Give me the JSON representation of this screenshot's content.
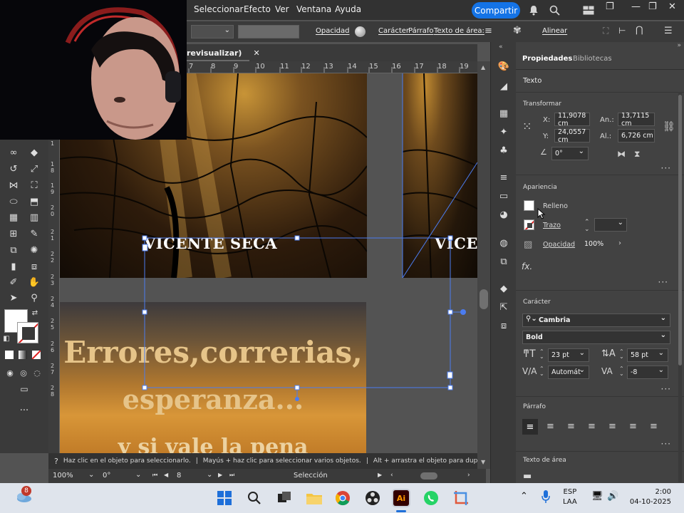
{
  "menu": {
    "items": [
      "Seleccionar",
      "Efecto",
      "Ver",
      "Ventana",
      "Ayuda"
    ],
    "share_label": "Compartir"
  },
  "controlbar": {
    "opacity_label": "Opacidad",
    "caracter_label": "Carácter",
    "parrafo_label": "Párrafo",
    "texto_area_label": "Texto de área:",
    "alinear_label": "Alinear"
  },
  "document": {
    "tab_title": "revisualizar)",
    "ruler_top": [
      "7",
      "8",
      "9",
      "10",
      "11",
      "12",
      "13",
      "14",
      "15",
      "16",
      "17",
      "18",
      "19"
    ],
    "ruler_left": [
      "1",
      "1",
      "8",
      "1",
      "9",
      "2",
      "0",
      "2",
      "1",
      "2",
      "2",
      "2",
      "3",
      "2",
      "4",
      "2",
      "5",
      "2",
      "6",
      "2",
      "7",
      "2",
      "8"
    ]
  },
  "canvas": {
    "heading_text": "VICENTE SECA",
    "heading_text_clipped": "VICE",
    "quote_line1": "Errores,correrias,",
    "quote_line2": "esperanza...",
    "quote_line3": "y si  vale la pena"
  },
  "status": {
    "hint_1": "Haz clic en el objeto para seleccionarlo.",
    "hint_2": "Mayús + haz clic para seleccionar varios objetos.",
    "hint_3": "Alt + arrastra el objeto para duplicarlo.",
    "zoom": "100%",
    "rotation": "0°",
    "artboard": "8",
    "tool_name": "Selección"
  },
  "panel": {
    "tab_properties": "Propiedades",
    "tab_libraries": "Bibliotecas",
    "section_text": "Texto",
    "transform": {
      "title": "Transformar",
      "x_label": "X:",
      "x_value": "11,9078 cm",
      "y_label": "Y:",
      "y_value": "24,0557 cm",
      "w_label": "An.:",
      "w_value": "13,7115 cm",
      "h_label": "Al.:",
      "h_value": "6,726 cm",
      "angle_value": "0°"
    },
    "appearance": {
      "title": "Apariencia",
      "fill_label": "Relleno",
      "stroke_label": "Trazo",
      "opacity_label": "Opacidad",
      "opacity_value": "100%"
    },
    "fx_label": "fx.",
    "character": {
      "title": "Carácter",
      "font_family": "Cambria",
      "font_style": "Bold",
      "font_size": "23 pt",
      "leading": "58 pt",
      "kerning": "Automát",
      "tracking": "-8"
    },
    "paragraph": {
      "title": "Párrafo"
    },
    "area_text": {
      "title": "Texto de área"
    }
  },
  "taskbar": {
    "notification_count": "8",
    "language_line1": "ESP",
    "language_line2": "LAA",
    "time": "2:00",
    "date": "04-10-2025"
  },
  "colors": {
    "accent": "#1473e6",
    "selection": "#4b7cf0"
  }
}
